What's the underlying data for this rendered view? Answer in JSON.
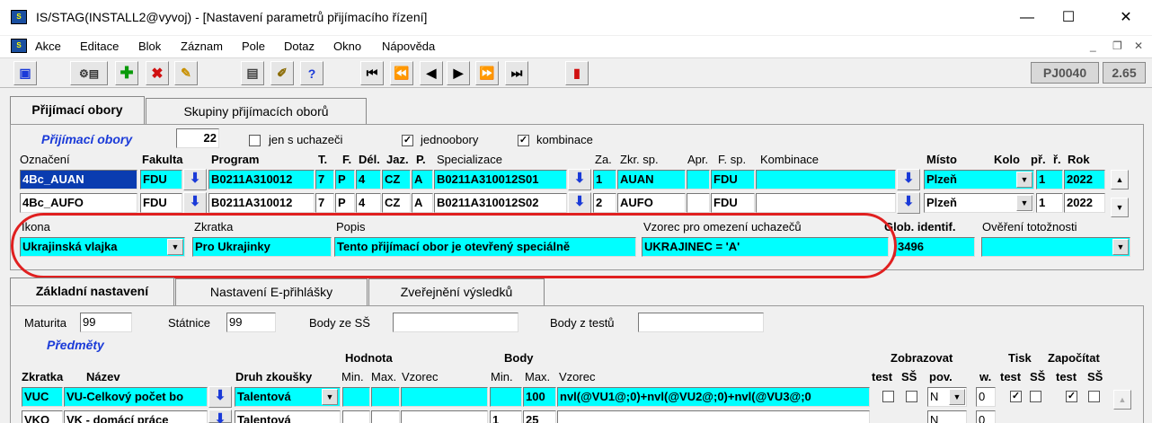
{
  "window": {
    "title": "IS/STAG(INSTALL2@vyvoj) - [Nastavení parametrů přijímacího řízení]",
    "app_icon_text": "S"
  },
  "menu": [
    {
      "label": "Akce"
    },
    {
      "label": "Editace"
    },
    {
      "label": "Blok"
    },
    {
      "label": "Záznam"
    },
    {
      "label": "Pole"
    },
    {
      "label": "Dotaz"
    },
    {
      "label": "Okno"
    },
    {
      "label": "Nápověda"
    }
  ],
  "toolbar": {
    "form_code": "PJ0040",
    "version": "2.65"
  },
  "tabs_top": [
    {
      "label": "Přijímací obory"
    },
    {
      "label": "Skupiny přijímacích oborů"
    }
  ],
  "obory": {
    "section_label": "Přijímací obory",
    "count": "22",
    "filters": [
      {
        "label": "jen s uchazeči",
        "checked": false
      },
      {
        "label": "jednoobory",
        "checked": true
      },
      {
        "label": "kombinace",
        "checked": true
      }
    ],
    "headers": {
      "oznaceni": "Označení",
      "fakulta": "Fakulta",
      "program": "Program",
      "t": "T.",
      "f": "F.",
      "del": "Dél.",
      "jaz": "Jaz.",
      "p": "P.",
      "specializace": "Specializace",
      "za": "Za.",
      "zkr_sp": "Zkr. sp.",
      "apr": "Apr.",
      "f_sp": "F. sp.",
      "kombinace": "Kombinace",
      "misto": "Místo",
      "kolo": "Kolo",
      "pr": "př.",
      "r": "ř.",
      "rok": "Rok"
    },
    "rows": [
      {
        "oznaceni": "4Bc_AUAN",
        "fakulta": "FDU",
        "program": "B0211A310012",
        "t": "7",
        "f": "P",
        "del": "4",
        "jaz": "CZ",
        "p": "A",
        "specializace": "B0211A310012S01",
        "za": "1",
        "zkr_sp": "AUAN",
        "apr": "",
        "f_sp": "FDU",
        "kombinace": "",
        "misto": "Plzeň",
        "kolo": "1",
        "rok": "2022"
      },
      {
        "oznaceni": "4Bc_AUFO",
        "fakulta": "FDU",
        "program": "B0211A310012",
        "t": "7",
        "f": "P",
        "del": "4",
        "jaz": "CZ",
        "p": "A",
        "specializace": "B0211A310012S02",
        "za": "2",
        "zkr_sp": "AUFO",
        "apr": "",
        "f_sp": "FDU",
        "kombinace": "",
        "misto": "Plzeň",
        "kolo": "1",
        "rok": "2022"
      }
    ],
    "detail": {
      "ikona_label": "Ikona",
      "ikona_value": "Ukrajinská vlajka",
      "zkratka_label": "Zkratka",
      "zkratka_value": "Pro Ukrajinky",
      "popis_label": "Popis",
      "popis_value": "Tento přijímací obor je otevřený speciálně",
      "vzorec_label": "Vzorec pro omezení uchazečů",
      "vzorec_value": "UKRAJINEC = 'A'",
      "glob_label": "Glob. identif.",
      "glob_value": "3496",
      "overeni_label": "Ověření totožnosti",
      "overeni_value": ""
    }
  },
  "tabs_bottom": [
    {
      "label": "Základní nastavení"
    },
    {
      "label": "Nastavení E-přihlášky"
    },
    {
      "label": "Zveřejnění výsledků"
    }
  ],
  "zakladni": {
    "maturita_label": "Maturita",
    "maturita_value": "99",
    "statnice_label": "Státnice",
    "statnice_value": "99",
    "body_ss_label": "Body ze SŠ",
    "body_ss_value": "",
    "body_testu_label": "Body z testů",
    "body_testu_value": ""
  },
  "predmety": {
    "section_label": "Předměty",
    "headers": {
      "hodnota": "Hodnota",
      "body": "Body",
      "zobrazovat": "Zobrazovat",
      "tisk": "Tisk",
      "zapocitat": "Započítat",
      "zkratka": "Zkratka",
      "nazev": "Název",
      "druh": "Druh zkoušky",
      "min": "Min.",
      "max": "Max.",
      "vzorec": "Vzorec",
      "test": "test",
      "ss": "SŠ",
      "pov": "pov.",
      "w": "w."
    },
    "rows": [
      {
        "zkratka": "VUC",
        "nazev": "VU-Celkový počet bo",
        "druh": "Talentová",
        "hmin": "",
        "hmax": "",
        "hvzorec": "",
        "bmin": "",
        "bmax": "100",
        "bvzorec": "nvl(@VU1@;0)+nvl(@VU2@;0)+nvl(@VU3@;0",
        "pov": "N",
        "w": "0"
      },
      {
        "zkratka": "VKO",
        "nazev": "VK - domácí práce",
        "druh": "Talentová",
        "hmin": "",
        "hmax": "",
        "hvzorec": "",
        "bmin": "1",
        "bmax": "25",
        "bvzorec": "",
        "pov": "N",
        "w": "0"
      }
    ]
  }
}
